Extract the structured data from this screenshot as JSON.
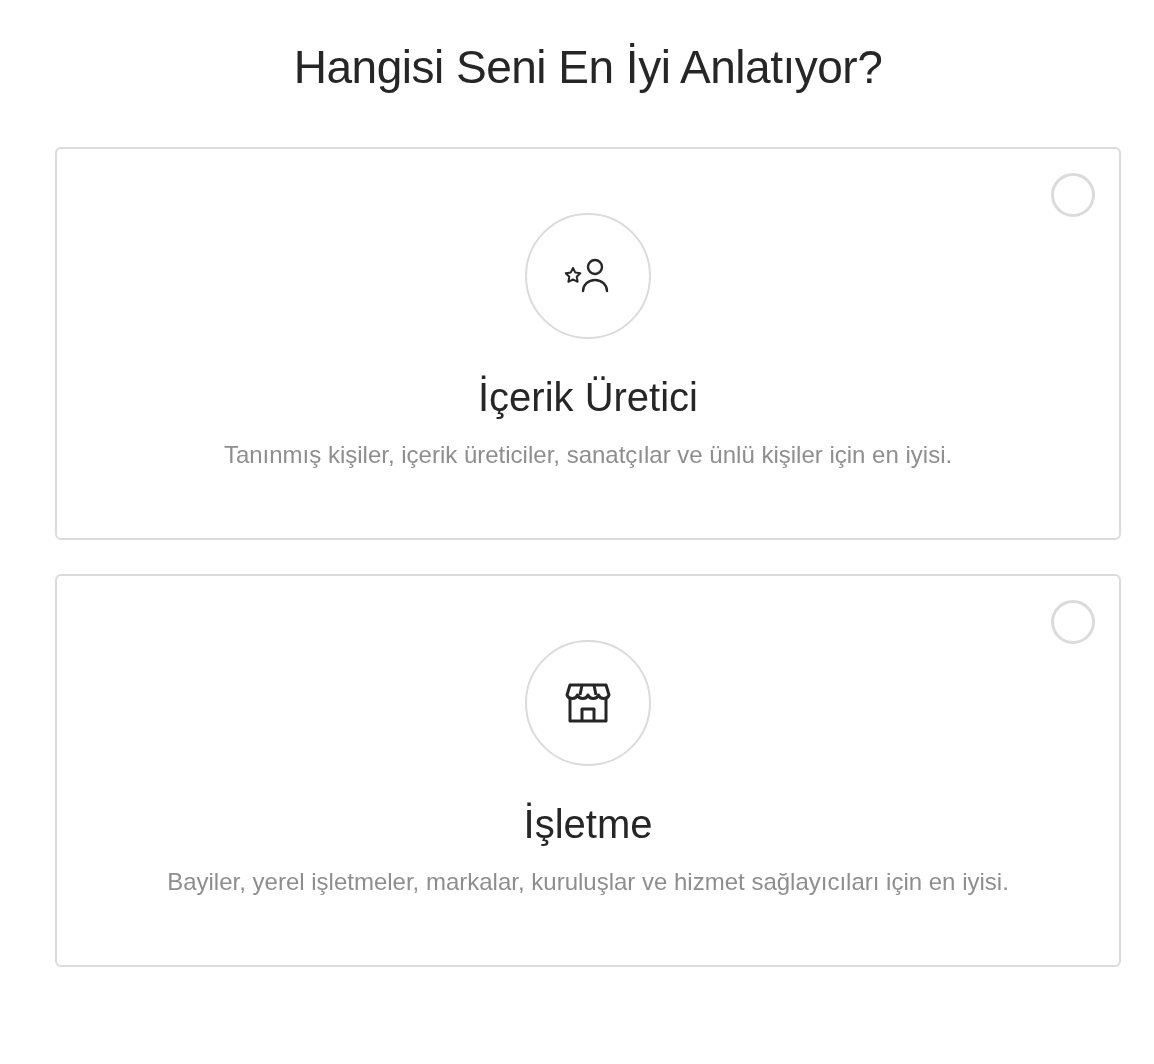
{
  "title": "Hangisi Seni En İyi Anlatıyor?",
  "options": [
    {
      "kind": "creator",
      "title": "İçerik Üretici",
      "description": "Tanınmış kişiler, içerik üreticiler, sanatçılar ve ünlü kişiler için en iyisi.",
      "selected": false
    },
    {
      "kind": "business",
      "title": "İşletme",
      "description": "Bayiler, yerel işletmeler, markalar, kuruluşlar ve hizmet sağlayıcıları için en iyisi.",
      "selected": false
    }
  ]
}
